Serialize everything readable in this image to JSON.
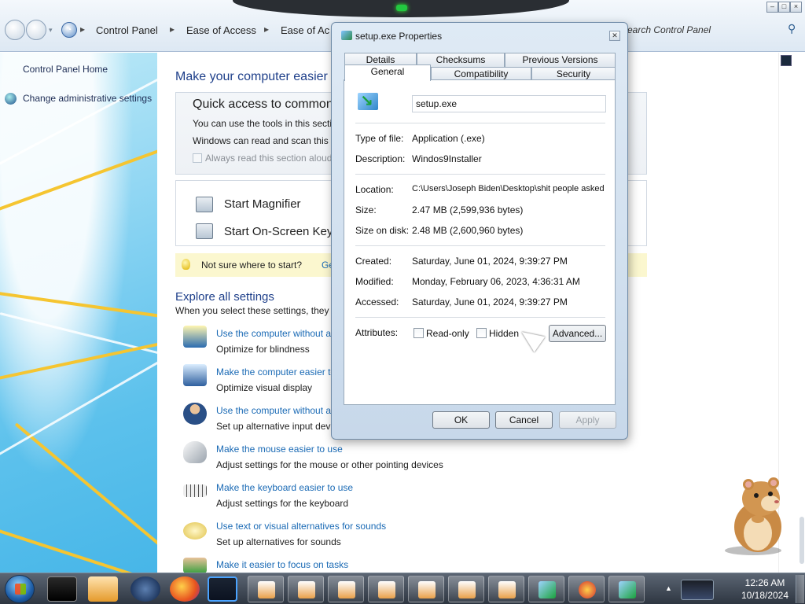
{
  "breadcrumb": {
    "items": [
      "Control Panel",
      "Ease of Access",
      "Ease of Ac"
    ],
    "search_placeholder": "Search Control Panel"
  },
  "window_controls": {
    "minimize": "–",
    "maximize": "□",
    "close": "×"
  },
  "leftpane": {
    "home": "Control Panel Home",
    "admin": "Change administrative settings"
  },
  "main": {
    "title": "Make your computer easier t",
    "quick_title": "Quick access to common t",
    "quick_line1": "You can use the tools in this sectio",
    "quick_line2": "Windows can read and scan this li",
    "always_read": "Always read this section aloud",
    "tools": [
      "Start Magnifier",
      "Start On-Screen Key"
    ],
    "hint": "Not sure where to start?",
    "hint_link": "Get rec",
    "explore_title": "Explore all settings",
    "explore_sub": "When you select these settings, they w",
    "items": [
      {
        "link": "Use the computer without a",
        "desc": "Optimize for blindness",
        "icon": "monitor-icon"
      },
      {
        "link": "Make the computer easier to",
        "desc": "Optimize visual display",
        "icon": "magnifier-monitor-icon"
      },
      {
        "link": "Use the computer without a",
        "desc": "Set up alternative input devi",
        "icon": "person-icon"
      },
      {
        "link": "Make the mouse easier to use",
        "desc": "Adjust settings for the mouse or other pointing devices",
        "icon": "mouse-icon"
      },
      {
        "link": "Make the keyboard easier to use",
        "desc": "Adjust settings for the keyboard",
        "icon": "keyboard-icon"
      },
      {
        "link": "Use text or visual alternatives for sounds",
        "desc": "Set up alternatives for sounds",
        "icon": "speech-bubble-icon"
      },
      {
        "link": "Make it easier to focus on tasks",
        "desc": "",
        "icon": "focus-icon"
      }
    ]
  },
  "dialog": {
    "title": "setup.exe Properties",
    "tabs_row1": [
      "Details",
      "Checksums",
      "Previous Versions"
    ],
    "tabs_row2": [
      "General",
      "Compatibility",
      "Security"
    ],
    "active_tab": "General",
    "filename": "setup.exe",
    "props": {
      "type_label": "Type of file:",
      "type": "Application (.exe)",
      "desc_label": "Description:",
      "desc": "Windos9Installer",
      "location_label": "Location:",
      "location": "C:\\Users\\Joseph Biden\\Desktop\\shit people asked",
      "size_label": "Size:",
      "size": "2.47 MB (2,599,936 bytes)",
      "disk_label": "Size on disk:",
      "disk": "2.48 MB (2,600,960 bytes)",
      "created_label": "Created:",
      "created": "Saturday, June 01, 2024, 9:39:27 PM",
      "modified_label": "Modified:",
      "modified": "Monday, February 06, 2023, 4:36:31 AM",
      "accessed_label": "Accessed:",
      "accessed": "Saturday, June 01, 2024, 9:39:27 PM",
      "attr_label": "Attributes:",
      "readonly": "Read-only",
      "hidden": "Hidden",
      "advanced": "Advanced..."
    },
    "buttons": {
      "ok": "OK",
      "cancel": "Cancel",
      "apply": "Apply"
    }
  },
  "taskbar": {
    "time": "12:26 AM",
    "date": "10/18/2024"
  }
}
